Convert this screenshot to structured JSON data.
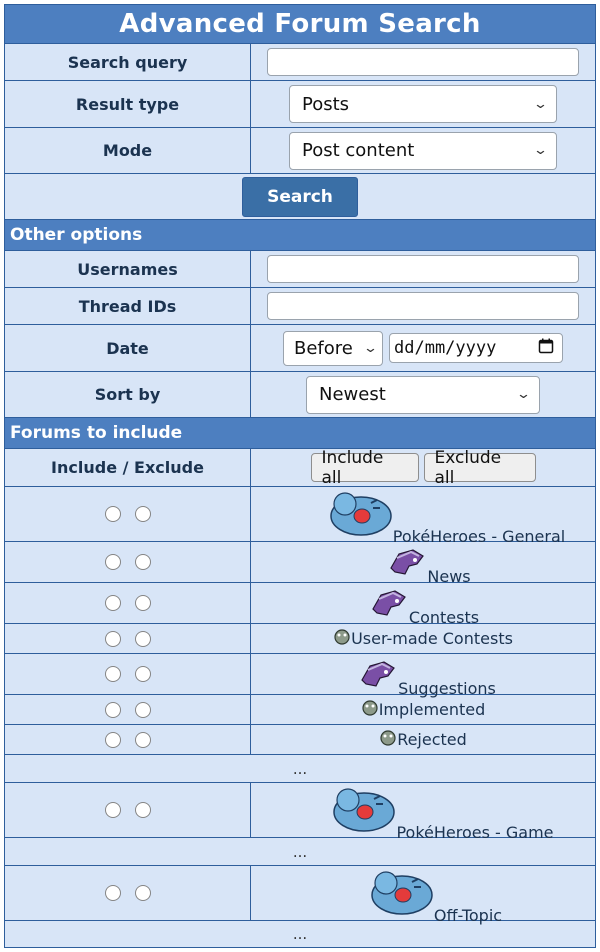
{
  "title": "Advanced Forum Search",
  "search_query": {
    "label": "Search query",
    "value": "",
    "placeholder": ""
  },
  "result_type": {
    "label": "Result type",
    "value": "Posts"
  },
  "mode": {
    "label": "Mode",
    "value": "Post content"
  },
  "search_button": "Search",
  "other_options": {
    "heading": "Other options",
    "usernames_label": "Usernames",
    "thread_ids_label": "Thread IDs",
    "date_label": "Date",
    "date_mode": "Before",
    "date_placeholder": "dd/mm/yyyy",
    "sort_label": "Sort by",
    "sort_value": "Newest"
  },
  "forums": {
    "heading": "Forums to include",
    "include_exclude_label": "Include / Exclude",
    "include_all": "Include all",
    "exclude_all": "Exclude all",
    "ellipsis": "...",
    "items": [
      {
        "name": "PokéHeroes - General",
        "icon": "wobbuffet-icon"
      },
      {
        "name": "News",
        "icon": "suicune-icon"
      },
      {
        "name": "Contests",
        "icon": "suicune-icon"
      },
      {
        "name": "User-made Contests",
        "icon": "small-pokemon-icon"
      },
      {
        "name": "Suggestions",
        "icon": "suicune-icon"
      },
      {
        "name": "Implemented",
        "icon": "small-pokemon-icon"
      },
      {
        "name": "Rejected",
        "icon": "small-pokemon-icon"
      },
      {
        "name": "PokéHeroes - Game",
        "icon": "wobbuffet-icon"
      },
      {
        "name": "Off-Topic",
        "icon": "wobbuffet-icon"
      }
    ]
  }
}
